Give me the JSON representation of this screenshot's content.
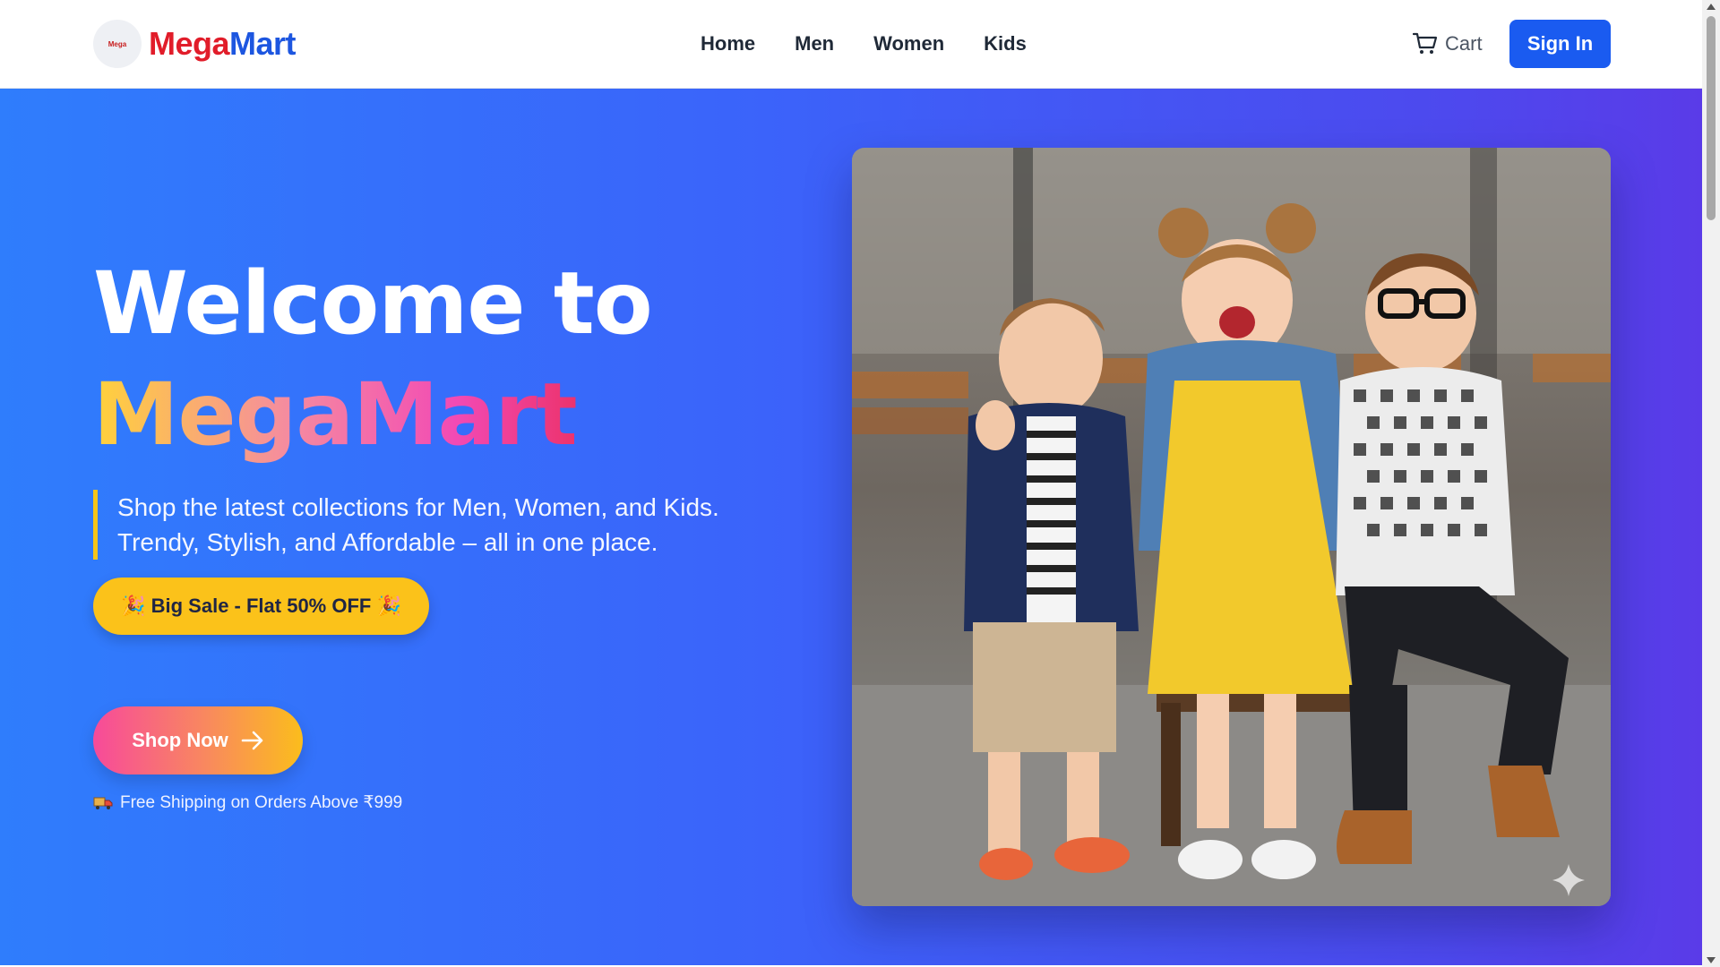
{
  "brand": {
    "logo_text": "Mega",
    "name_part1": "Mega",
    "name_part2": "Mart"
  },
  "nav": {
    "links": [
      "Home",
      "Men",
      "Women",
      "Kids"
    ],
    "cart_label": "Cart",
    "signin_label": "Sign In"
  },
  "hero": {
    "title_line1": "Welcome to",
    "title_line2": "MegaMart",
    "description": "Shop the latest collections for Men, Women, and Kids. Trendy, Stylish, and Affordable – all in one place.",
    "sale_badge": "🎉 Big Sale - Flat 50% OFF 🎉",
    "shop_button": "Shop Now",
    "shipping_text": "Free Shipping on Orders Above ₹999"
  },
  "icons": {
    "cart": "shopping-cart-icon",
    "arrow": "arrow-right-icon",
    "truck": "delivery-truck-icon",
    "sparkle": "sparkle-icon"
  },
  "colors": {
    "brand_red": "#e11d2a",
    "brand_blue": "#1d56e0",
    "signin_bg": "#1a5bf0",
    "sale_badge_bg": "#fbc21a",
    "hero_gradient_start": "#2f7dfc",
    "hero_gradient_end": "#5a3be8",
    "accent_bar": "#f5c518"
  }
}
